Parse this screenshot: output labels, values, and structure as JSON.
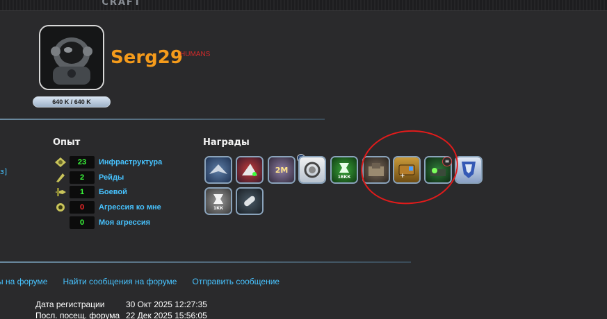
{
  "header": {
    "logo_text": "CRAFT"
  },
  "profile": {
    "username": "Serg29",
    "race": "HUMANS",
    "energy": "640 K / 640 K"
  },
  "experience": {
    "title": "Опыт",
    "stats": [
      {
        "value": "23",
        "label": "Инфраструктура",
        "color": "#3cff3c",
        "icon": "infrastructure-icon"
      },
      {
        "value": "2",
        "label": "Рейды",
        "color": "#3cff3c",
        "icon": "raids-icon"
      },
      {
        "value": "1",
        "label": "Боевой",
        "color": "#3cff3c",
        "icon": "combat-icon"
      },
      {
        "value": "0",
        "label": "Агрессия ко мне",
        "color": "#ff2a2a",
        "icon": "aggression-to-me-icon"
      },
      {
        "value": "0",
        "label": "Моя агрессия",
        "color": "#3cff3c",
        "icon": "my-aggression-icon"
      }
    ]
  },
  "awards": {
    "title": "Награды",
    "items": [
      {
        "icon": "spaceship-award-icon"
      },
      {
        "icon": "red-ship-award-icon"
      },
      {
        "icon": "2m-award-icon"
      },
      {
        "icon": "magnifier-award-icon"
      },
      {
        "icon": "green-1kk-award-icon",
        "caption": "1ВКК"
      },
      {
        "icon": "base-award-icon"
      },
      {
        "icon": "crate-award-icon"
      },
      {
        "icon": "green-base-award-icon"
      },
      {
        "icon": "faction-award-icon"
      },
      {
        "icon": "gray-1kk-award-icon",
        "caption": "1КК"
      },
      {
        "icon": "capsule-award-icon"
      }
    ]
  },
  "links": {
    "forum_topics": "ы на форуме",
    "find_posts": "Найти сообщения на форуме",
    "send_message": "Отправить сообщение"
  },
  "info": {
    "registered_label": "Дата регистрации",
    "registered_value": "30 Окт 2025 12:27:35",
    "last_visit_label": "Посл. посещ. форума",
    "last_visit_value": "22 Дек 2025 15:56:05"
  },
  "side": {
    "bracket": "з]"
  },
  "colors": {
    "accent_name": "#f59b1b",
    "link": "#47c3ff",
    "race": "#d42a2a",
    "annotation": "#e11b1b"
  }
}
